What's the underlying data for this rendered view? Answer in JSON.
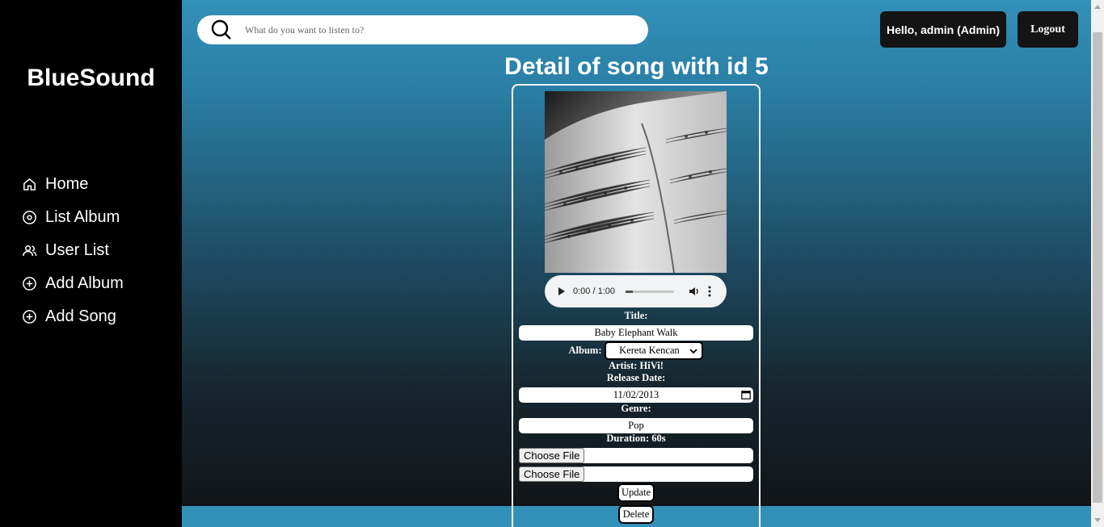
{
  "app": {
    "name": "BlueSound"
  },
  "sidebar": {
    "items": [
      {
        "label": "Home",
        "icon": "home-icon"
      },
      {
        "label": "List Album",
        "icon": "disc-icon"
      },
      {
        "label": "User List",
        "icon": "users-icon"
      },
      {
        "label": "Add Album",
        "icon": "plus-circle-icon"
      },
      {
        "label": "Add Song",
        "icon": "plus-circle-icon"
      }
    ]
  },
  "header": {
    "search_placeholder": "What do you want to listen to?",
    "greeting": "Hello, admin (Admin)",
    "logout_label": "Logout"
  },
  "page": {
    "title": "Detail of song with id 5"
  },
  "song": {
    "player_time": "0:00 / 1:00",
    "title_label": "Title:",
    "title_value": "Baby Elephant Walk",
    "album_label": "Album:",
    "album_value": "Kereta Kencan",
    "artist_text": "Artist: HiVi!",
    "release_label": "Release Date:",
    "release_value": "11/02/2013",
    "genre_label": "Genre:",
    "genre_value": "Pop",
    "duration_text": "Duration: 60s",
    "file_button_label": "Choose File",
    "update_label": "Update",
    "delete_label": "Delete"
  },
  "colors": {
    "sidebar_bg": "#000000",
    "accent": "#3390b8",
    "button_dark": "#141414"
  }
}
